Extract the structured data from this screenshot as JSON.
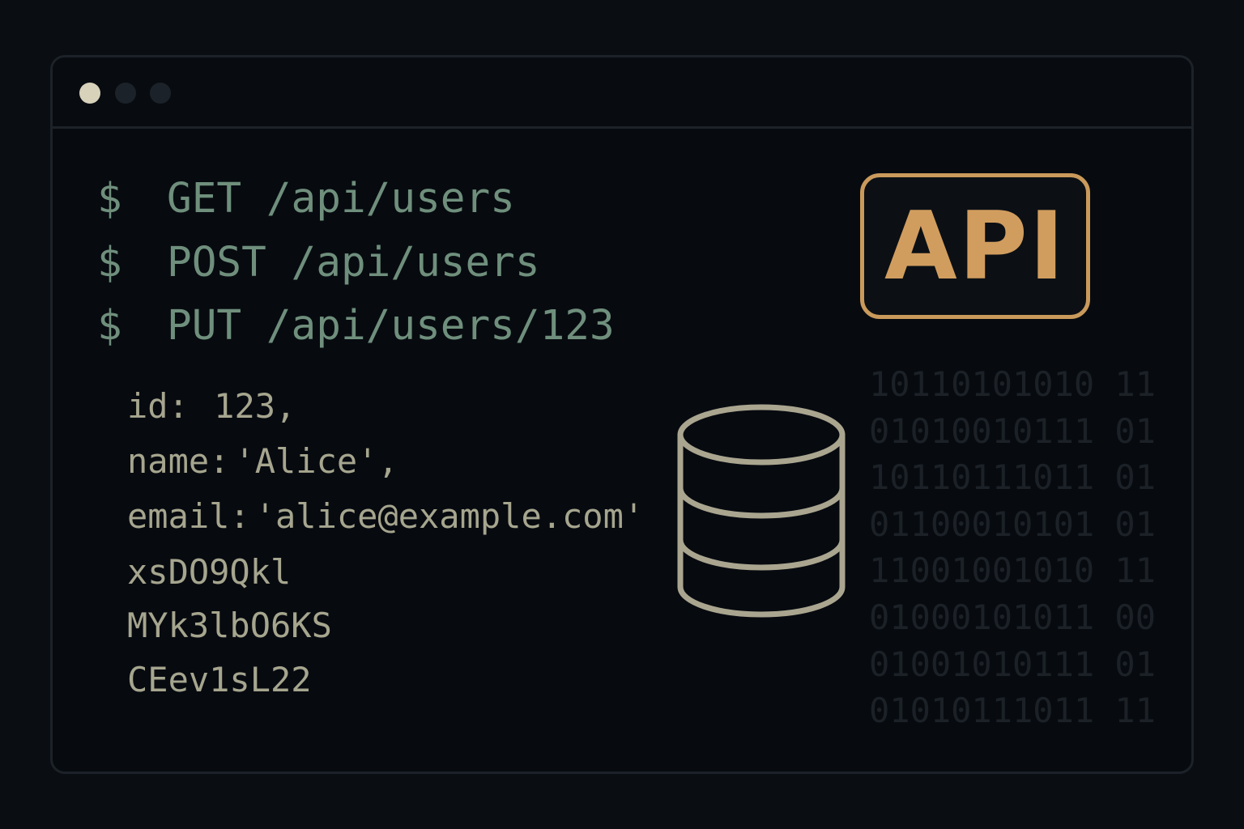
{
  "window": {
    "controls": [
      "close",
      "minimize",
      "maximize"
    ]
  },
  "terminal": {
    "prompt": "$",
    "commands": [
      {
        "method": "GET",
        "path": "/api/users"
      },
      {
        "method": "POST",
        "path": "/api/users"
      },
      {
        "method": "PUT",
        "path": "/api/users/123"
      }
    ],
    "response": {
      "id_key": "id:",
      "id_value": "123,",
      "name_key": "name:",
      "name_value": "'Alice',",
      "email_key": "email:",
      "email_value": "'alice@example.com'",
      "tokens": [
        "xsDO9Qkl",
        "MYk3lbO6KS",
        "CEev1sL22"
      ]
    }
  },
  "api_badge": {
    "label": "API"
  },
  "binary": [
    "10110101010 11",
    "01010010111 01",
    "10110111011 01",
    "01100010101 01",
    "11001001010 11",
    "01000101011 00",
    "01001010111 01",
    "01010111011 11"
  ],
  "icons": {
    "database": "database-icon"
  },
  "colors": {
    "background": "#0a0e13",
    "command_text": "#6f8f7c",
    "response_text": "#a6a58e",
    "accent": "#c99a5b",
    "binary_text": "#1b2127"
  }
}
